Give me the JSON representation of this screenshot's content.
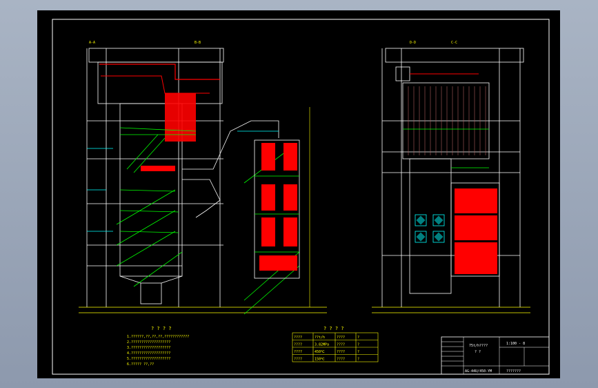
{
  "view_titles": {
    "main": "A-A",
    "section_b": "B-B",
    "section_c": "C-C",
    "side": "D-D"
  },
  "notes": {
    "heading": "? ? ? ?",
    "lines": [
      "1.??????,??,??,??,????????????",
      "2.???????????????????",
      "3.???????????????????",
      "4.???????????????????",
      "5.???????????????????",
      "6.????? ??,??"
    ]
  },
  "spec_table": {
    "heading": "? ? ? ?",
    "rows": [
      [
        "????",
        "??t/h",
        "????",
        "?"
      ],
      [
        "????",
        "3.82MPa",
        "????",
        "?"
      ],
      [
        "????",
        "450℃",
        "????",
        "?"
      ],
      [
        "????",
        "150℃",
        "????",
        "?"
      ]
    ]
  },
  "title_block": {
    "project": "75t/h????",
    "drawing_title": "? ?",
    "scale": "1:100 - 8",
    "drawing_no": "AG-44U/450-YM",
    "company": "???????"
  },
  "colors": {
    "background": "#000000",
    "outline": "#ffffff",
    "dimension": "#ffff00",
    "pipe": "#00ff00",
    "heater": "#ff0000",
    "structure": "#00ffff"
  }
}
